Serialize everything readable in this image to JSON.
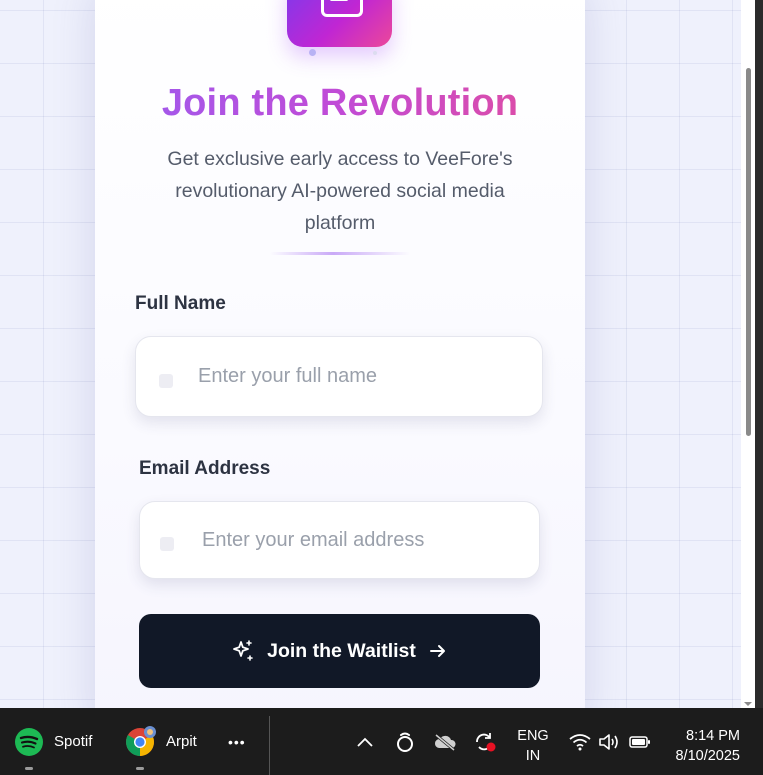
{
  "signup": {
    "title": "Join the Revolution",
    "subtitle": "Get exclusive early access to VeeFore's revolutionary AI-powered social media platform",
    "full_name_label": "Full Name",
    "full_name_placeholder": "Enter your full name",
    "email_label": "Email Address",
    "email_placeholder": "Enter your email address",
    "cta_label": "Join the Waitlist"
  },
  "taskbar": {
    "apps": [
      {
        "label": "Spotif",
        "icon": "spotify-icon"
      },
      {
        "label": "Arpit",
        "icon": "chrome-icon"
      }
    ],
    "more_label": "•••",
    "lang_line1": "ENG",
    "lang_line2": "IN",
    "time": "8:14 PM",
    "date": "8/10/2025"
  },
  "colors": {
    "cta_bg": "#111827",
    "title_gradient_start": "#9b5cf0",
    "title_gradient_end": "#e44c9a",
    "spotify_green": "#1db954"
  }
}
